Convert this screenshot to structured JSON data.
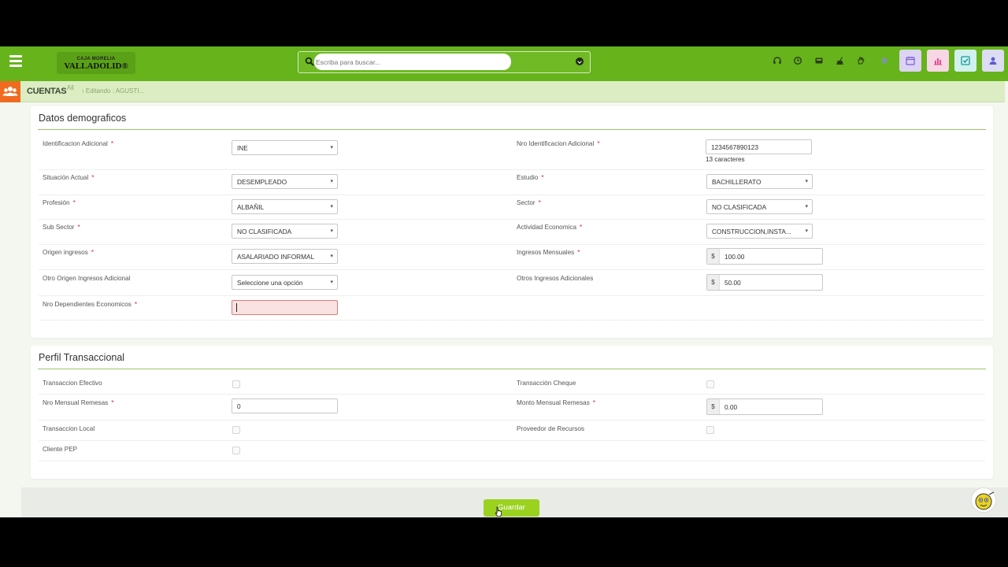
{
  "header": {
    "logo_line1": "CAJA MORELIA",
    "logo_line2": "VALLADOLID®",
    "search_placeholder": "Escriba para buscar..."
  },
  "breadcrumb": {
    "title": "CUENTAS",
    "all": "All",
    "editing": "Editando : AGUSTI..."
  },
  "demograficos": {
    "title": "Datos demograficos",
    "required_mark": "*",
    "fields": {
      "identificacion_label": "Identificacion Adicional",
      "identificacion_value": "INE",
      "nro_identificacion_label": "Nro Identificacion Adicional",
      "nro_identificacion_value": "1234567890123",
      "nro_identificacion_hint": "13 caracteres",
      "situacion_label": "Situación Actual",
      "situacion_value": "DESEMPLEADO",
      "estudio_label": "Estudio",
      "estudio_value": "BACHILLERATO",
      "profesion_label": "Profesión",
      "profesion_value": "ALBAÑIL",
      "sector_label": "Sector",
      "sector_value": "NO CLASIFICADA",
      "subsector_label": "Sub Sector",
      "subsector_value": "NO CLASIFICADA",
      "actividad_label": "Actividad Economica",
      "actividad_value": "CONSTRUCCION,INSTA...",
      "origen_label": "Origen ingresos",
      "origen_value": "ASALARIADO INFORMAL",
      "ingresos_label": "Ingresos Mensuales",
      "ingresos_currency": "$",
      "ingresos_value": "100.00",
      "otro_origen_label": "Otro Origen Ingresos Adicional",
      "otro_origen_value": "Seleccione una opción",
      "otros_ingresos_label": "Otros Ingresos Adicionales",
      "otros_ingresos_currency": "$",
      "otros_ingresos_value": "50.00",
      "dependientes_label": "Nro Dependientes Economicos",
      "dependientes_value": ""
    }
  },
  "transaccional": {
    "title": "Perfil Transaccional",
    "fields": {
      "efectivo_label": "Transaccion Efectivo",
      "cheque_label": "Transacción Cheque",
      "remesas_label": "Nro Mensual Remesas",
      "remesas_value": "0",
      "monto_label": "Monto Mensual Remesas",
      "monto_currency": "$",
      "monto_value": "0.00",
      "local_label": "Transaccion Local",
      "proveedor_label": "Proveedor de Recursos",
      "pep_label": "Cliente PEP"
    }
  },
  "footer": {
    "save_label": "Guardar"
  },
  "colors": {
    "topbar": "#66b31b",
    "crumbbar": "#dcedc4",
    "accent_orange": "#f06b1f",
    "save": "#9ad21f",
    "app_calendar": "#ddd3f3",
    "app_chart": "#f7d6e6",
    "app_tasks": "#d2f0ee",
    "app_user": "#dcdcf3"
  }
}
